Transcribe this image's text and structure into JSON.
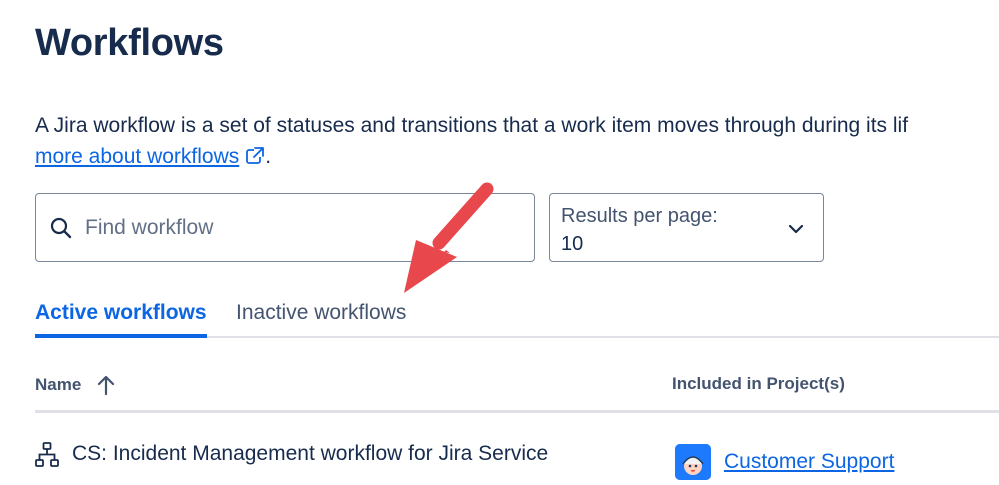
{
  "page": {
    "title": "Workflows",
    "description_line1": "A Jira workflow is a set of statuses and transitions that a work item moves through during its lif",
    "learn_link": "more about workflows",
    "description_end": "."
  },
  "search": {
    "placeholder": "Find workflow",
    "value": ""
  },
  "results_per_page": {
    "label": "Results per page:",
    "value": "10"
  },
  "tabs": [
    {
      "label": "Active workflows",
      "active": true
    },
    {
      "label": "Inactive workflows",
      "active": false
    }
  ],
  "table": {
    "columns": {
      "name": "Name",
      "projects": "Included in Project(s)"
    },
    "sort_icon": "arrow-up-icon",
    "rows": [
      {
        "name": "CS: Incident Management workflow for Jira Service",
        "project": "Customer Support"
      }
    ]
  },
  "annotation": {
    "arrow_color": "#e8474c"
  },
  "colors": {
    "accent": "#0c66e4",
    "text": "#172b4d",
    "subtle_text": "#44546f",
    "border": "#7a869a"
  }
}
